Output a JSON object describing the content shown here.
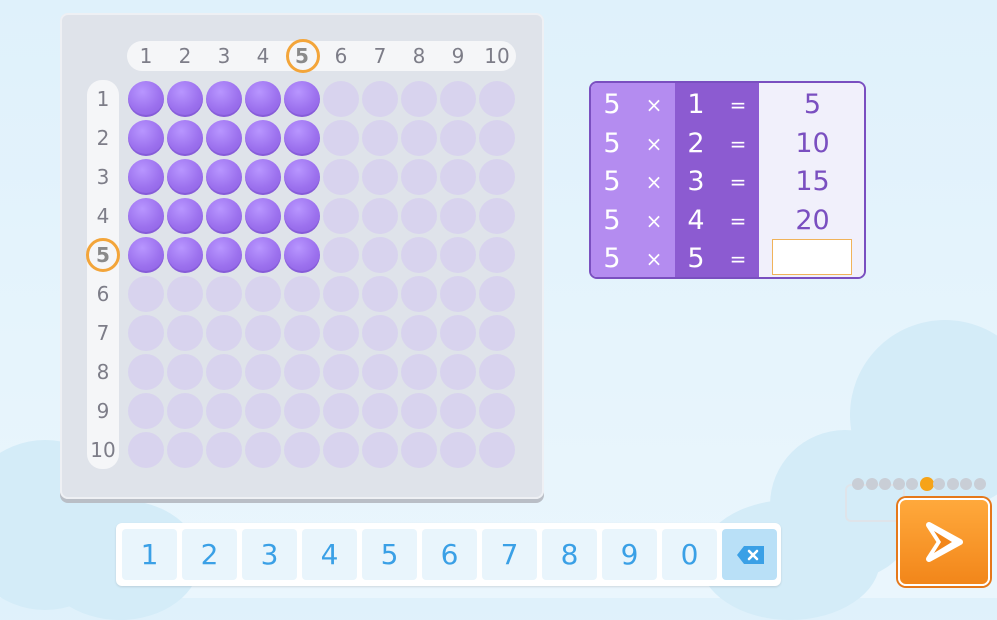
{
  "board": {
    "selected_column": 5,
    "selected_row": 5,
    "column_headers": [
      "1",
      "2",
      "3",
      "4",
      "5",
      "6",
      "7",
      "8",
      "9",
      "10"
    ],
    "row_headers": [
      "1",
      "2",
      "3",
      "4",
      "5",
      "6",
      "7",
      "8",
      "9",
      "10"
    ],
    "filled_columns": 5,
    "filled_rows": 5
  },
  "equations": [
    {
      "a": "5",
      "op": "×",
      "b": "1",
      "eq": "=",
      "result": "5"
    },
    {
      "a": "5",
      "op": "×",
      "b": "2",
      "eq": "=",
      "result": "10"
    },
    {
      "a": "5",
      "op": "×",
      "b": "3",
      "eq": "=",
      "result": "15"
    },
    {
      "a": "5",
      "op": "×",
      "b": "4",
      "eq": "=",
      "result": "20"
    },
    {
      "a": "5",
      "op": "×",
      "b": "5",
      "eq": "=",
      "result": ""
    }
  ],
  "keypad": {
    "keys": [
      "1",
      "2",
      "3",
      "4",
      "5",
      "6",
      "7",
      "8",
      "9",
      "0"
    ],
    "delete_icon": "backspace-icon"
  },
  "progress": {
    "total": 10,
    "current": 6
  },
  "next_button": {
    "icon": "arrow-right-icon"
  },
  "colors": {
    "accent": "#9c71ee",
    "highlight": "#f3a53a",
    "keypad_text": "#3aa0e6",
    "next": "#f2861a"
  }
}
